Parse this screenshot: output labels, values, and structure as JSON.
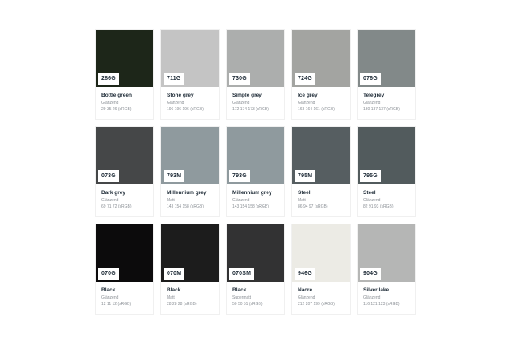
{
  "swatches": [
    {
      "code": "286G",
      "name": "Bottle green",
      "finish": "Glänzend",
      "rgb": "29 35 26 (sRGB)",
      "color": "#1d2619"
    },
    {
      "code": "711G",
      "name": "Stone grey",
      "finish": "Glänzend",
      "rgb": "196 196 196 (sRGB)",
      "color": "#c4c4c4"
    },
    {
      "code": "730G",
      "name": "Simple grey",
      "finish": "Glänzend",
      "rgb": "172 174 173 (sRGB)",
      "color": "#acaead"
    },
    {
      "code": "724G",
      "name": "Ice grey",
      "finish": "Glänzend",
      "rgb": "163 164 161 (sRGB)",
      "color": "#a3a4a1"
    },
    {
      "code": "076G",
      "name": "Telegrey",
      "finish": "Glänzend",
      "rgb": "130 137 137 (sRGB)",
      "color": "#828989"
    },
    {
      "code": "073G",
      "name": "Dark grey",
      "finish": "Glänzend",
      "rgb": "69 71 72 (sRGB)",
      "color": "#454748"
    },
    {
      "code": "793M",
      "name": "Millennium grey",
      "finish": "Matt",
      "rgb": "143 154 158 (sRGB)",
      "color": "#8f9a9e"
    },
    {
      "code": "793G",
      "name": "Millennium grey",
      "finish": "Glänzend",
      "rgb": "143 154 158 (sRGB)",
      "color": "#8f9a9e"
    },
    {
      "code": "795M",
      "name": "Steel",
      "finish": "Matt",
      "rgb": "86 94 97 (sRGB)",
      "color": "#565e61"
    },
    {
      "code": "795G",
      "name": "Steel",
      "finish": "Glänzend",
      "rgb": "82 91 93 (sRGB)",
      "color": "#525b5d"
    },
    {
      "code": "070G",
      "name": "Black",
      "finish": "Glänzend",
      "rgb": "12 11 12 (sRGB)",
      "color": "#0c0b0c"
    },
    {
      "code": "070M",
      "name": "Black",
      "finish": "Matt",
      "rgb": "28 28 28 (sRGB)",
      "color": "#1c1c1c"
    },
    {
      "code": "070SM",
      "name": "Black",
      "finish": "Supermatt",
      "rgb": "50 50 51 (sRGB)",
      "color": "#323233"
    },
    {
      "code": "946G",
      "name": "Nacre",
      "finish": "Glänzend",
      "rgb": "212 207 199 (sRGB)",
      "color": "#ecebe5"
    },
    {
      "code": "904G",
      "name": "Silver lake",
      "finish": "Glänzend",
      "rgb": "116 121 123 (sRGB)",
      "color": "#b5b6b5"
    }
  ]
}
